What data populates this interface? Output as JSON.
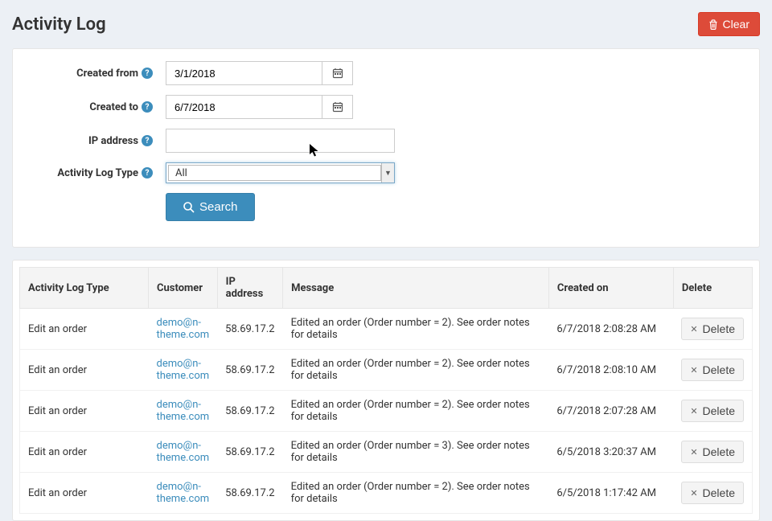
{
  "title": "Activity Log",
  "buttons": {
    "clear": "Clear",
    "search": "Search",
    "delete": "Delete"
  },
  "filters": {
    "created_from": {
      "label": "Created from",
      "value": "3/1/2018"
    },
    "created_to": {
      "label": "Created to",
      "value": "6/7/2018"
    },
    "ip_address": {
      "label": "IP address",
      "value": ""
    },
    "log_type": {
      "label": "Activity Log Type",
      "value": "All"
    }
  },
  "table": {
    "headers": {
      "type": "Activity Log Type",
      "customer": "Customer",
      "ip": "IP address",
      "message": "Message",
      "created": "Created on",
      "delete": "Delete"
    },
    "rows": [
      {
        "type": "Edit an order",
        "customer": "demo@n-theme.com",
        "ip": "58.69.17.2",
        "message": "Edited an order (Order number = 2). See order notes for details",
        "created": "6/7/2018 2:08:28 AM"
      },
      {
        "type": "Edit an order",
        "customer": "demo@n-theme.com",
        "ip": "58.69.17.2",
        "message": "Edited an order (Order number = 2). See order notes for details",
        "created": "6/7/2018 2:08:10 AM"
      },
      {
        "type": "Edit an order",
        "customer": "demo@n-theme.com",
        "ip": "58.69.17.2",
        "message": "Edited an order (Order number = 2). See order notes for details",
        "created": "6/7/2018 2:07:28 AM"
      },
      {
        "type": "Edit an order",
        "customer": "demo@n-theme.com",
        "ip": "58.69.17.2",
        "message": "Edited an order (Order number = 3). See order notes for details",
        "created": "6/5/2018 3:20:37 AM"
      },
      {
        "type": "Edit an order",
        "customer": "demo@n-theme.com",
        "ip": "58.69.17.2",
        "message": "Edited an order (Order number = 2). See order notes for details",
        "created": "6/5/2018 1:17:42 AM"
      }
    ]
  }
}
